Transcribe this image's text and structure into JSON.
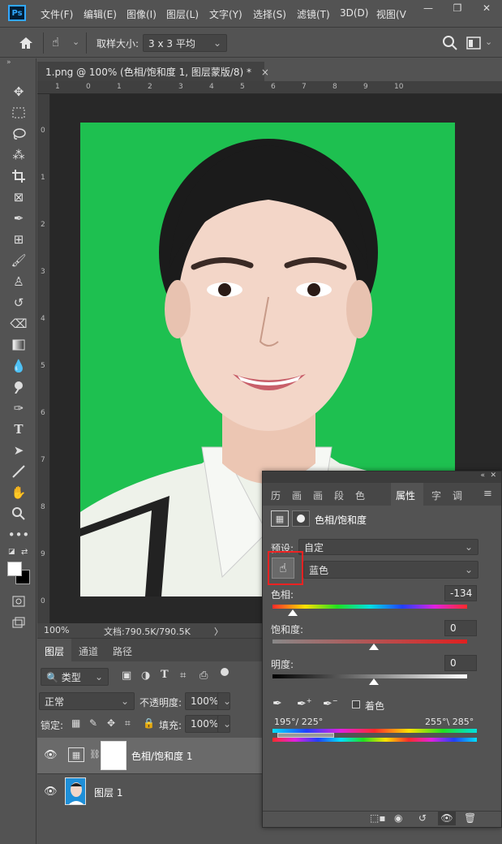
{
  "app": {
    "logo": "Ps"
  },
  "menu": [
    "文件(F)",
    "编辑(E)",
    "图像(I)",
    "图层(L)",
    "文字(Y)",
    "选择(S)",
    "滤镜(T)",
    "3D(D)",
    "视图(V"
  ],
  "window_controls": [
    "—",
    "❐",
    "✕"
  ],
  "options_bar": {
    "sample_size_label": "取样大小:",
    "sample_size_value": "3 x 3 平均"
  },
  "document_tab": {
    "title": "1.png @ 100% (色相/饱和度 1, 图层蒙版/8) *",
    "close": "×"
  },
  "ruler_top": [
    "1",
    "0",
    "1",
    "2",
    "3",
    "4",
    "5",
    "6",
    "7",
    "8",
    "9",
    "10"
  ],
  "ruler_left": [
    "0",
    "1",
    "2",
    "3",
    "4",
    "5",
    "6",
    "7",
    "8",
    "9",
    "0"
  ],
  "status": {
    "zoom": "100%",
    "doc": "文档:790.5K/790.5K",
    "arrow": "〉"
  },
  "layers_panel": {
    "tabs": [
      "图层",
      "通道",
      "路径"
    ],
    "filter_kind": "类型",
    "blend_mode": "正常",
    "opacity_label": "不透明度:",
    "opacity_value": "100%",
    "lock_label": "锁定:",
    "fill_label": "填充:",
    "fill_value": "100%",
    "layers": [
      {
        "name": "色相/饱和度 1",
        "type": "adjustment"
      },
      {
        "name": "图层 1",
        "type": "pixel"
      }
    ]
  },
  "properties_panel": {
    "tabs": [
      "历",
      "画",
      "画",
      "段",
      "色",
      "属性",
      "字",
      "调"
    ],
    "active_tab": "属性",
    "title": "色相/饱和度",
    "preset_label": "预设:",
    "preset_value": "自定",
    "channel_value": "蓝色",
    "hue_label": "色相:",
    "hue_value": "-134",
    "saturation_label": "饱和度:",
    "saturation_value": "0",
    "lightness_label": "明度:",
    "lightness_value": "0",
    "colorize_label": "着色",
    "range_left": "195°/ 225°",
    "range_right": "255°\\ 285°"
  }
}
